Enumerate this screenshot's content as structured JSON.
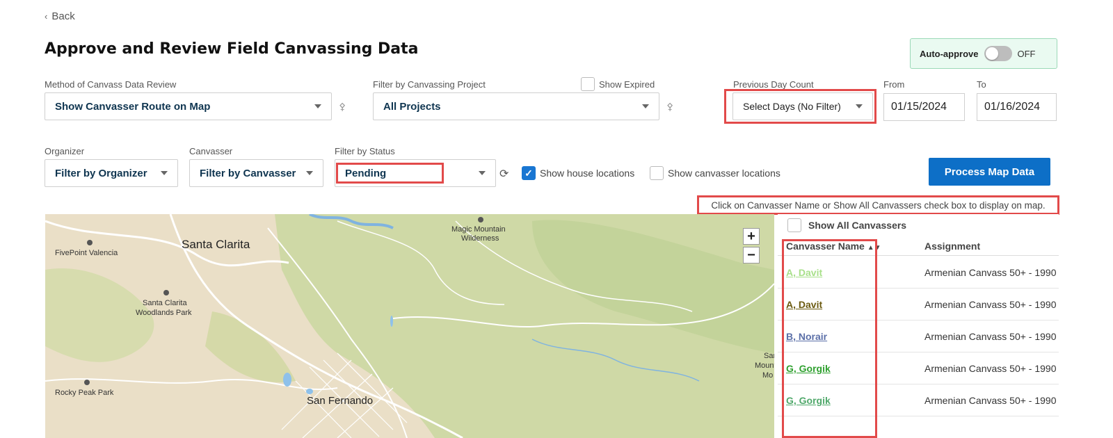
{
  "nav": {
    "back_label": "Back"
  },
  "page": {
    "title": "Approve and Review Field Canvassing Data"
  },
  "auto_approve": {
    "label": "Auto-approve",
    "state_label": "OFF",
    "enabled": false
  },
  "filters_row1": {
    "method_label": "Method of Canvass Data Review",
    "method_value": "Show Canvasser Route on Map",
    "project_label": "Filter by Canvassing Project",
    "project_value": "All Projects",
    "show_expired_label": "Show Expired",
    "prev_day_label": "Previous Day Count",
    "prev_day_value": "Select Days (No Filter)",
    "from_label": "From",
    "from_value": "01/15/2024",
    "to_label": "To",
    "to_value": "01/16/2024"
  },
  "filters_row2": {
    "organizer_label": "Organizer",
    "organizer_value": "Filter by Organizer",
    "canvasser_label": "Canvasser",
    "canvasser_value": "Filter by Canvasser",
    "status_label": "Filter by Status",
    "status_value": "Pending",
    "show_house_label": "Show house locations",
    "show_house_checked": true,
    "show_canvasser_label": "Show canvasser locations",
    "show_canvasser_checked": false,
    "process_button": "Process Map Data"
  },
  "hint": "Click on Canvasser Name or Show All Canvassers check box to display on map.",
  "map": {
    "labels": {
      "santa_clarita": "Santa Clarita",
      "fivepoint": "FivePoint Valencia",
      "woodlands_1": "Santa Clarita",
      "woodlands_2": "Woodlands Park",
      "magic_1": "Magic Mountain",
      "magic_2": "Wilderness",
      "rocky": "Rocky Peak Park",
      "san_fernando": "San Fernando",
      "edge_1": "Sar",
      "edge_2": "Mounta",
      "edge_3": "Mo"
    },
    "zoom_in": "+",
    "zoom_out": "−"
  },
  "canvasser_panel": {
    "show_all_label": "Show All Canvassers",
    "col_name": "Canvasser Name",
    "col_assignment": "Assignment",
    "rows": [
      {
        "name": "A, Davit",
        "assignment": "Armenian Canvass 50+ - 1990",
        "color": "#a8e08a"
      },
      {
        "name": "A, Davit",
        "assignment": "Armenian Canvass 50+ - 1990",
        "color": "#6b5a10"
      },
      {
        "name": "B, Norair",
        "assignment": "Armenian Canvass 50+ - 1990",
        "color": "#5b6fa8"
      },
      {
        "name": "G, Gorgik",
        "assignment": "Armenian Canvass 50+ - 1990",
        "color": "#2ea02e"
      },
      {
        "name": "G, Gorgik",
        "assignment": "Armenian Canvass 50+ - 1990",
        "color": "#4fa86a"
      }
    ]
  },
  "colors": {
    "primary_button": "#0d6fc7",
    "highlight_border": "#e24a4a",
    "select_text": "#0f3550",
    "auto_approve_bg": "#eafaf1"
  }
}
